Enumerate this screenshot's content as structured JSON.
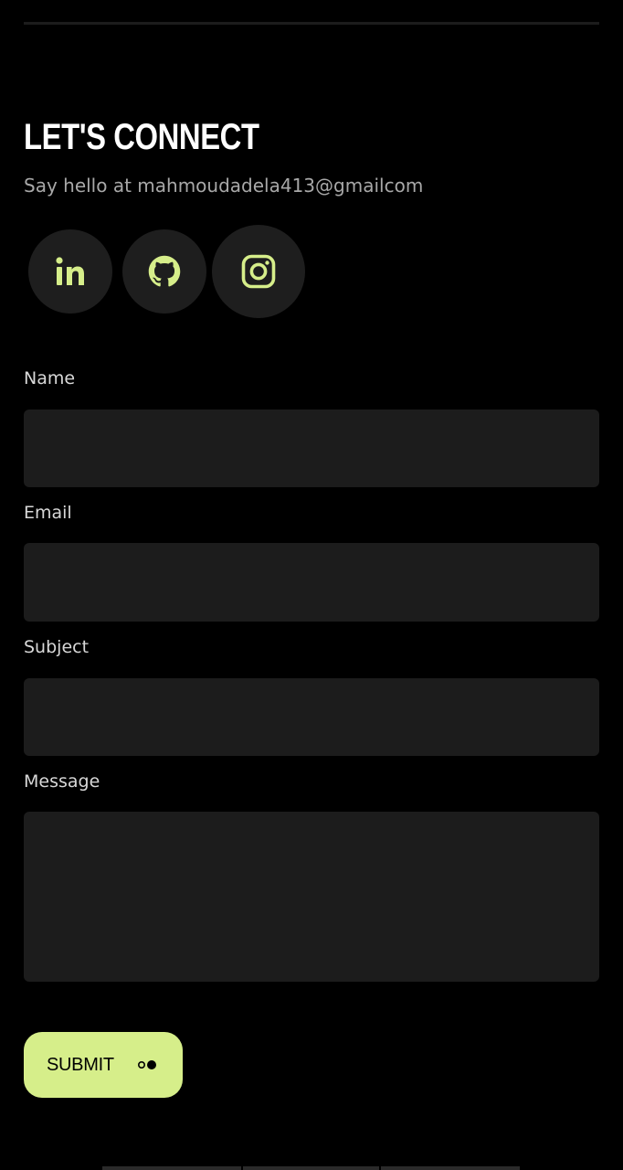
{
  "contact": {
    "heading": "LET'S CONNECT",
    "subtitle": "Say hello at mahmoudadela413@gmailcom"
  },
  "social": [
    {
      "name": "LinkedIn",
      "icon": "linkedin-icon"
    },
    {
      "name": "GitHub",
      "icon": "github-icon"
    },
    {
      "name": "Instagram",
      "icon": "instagram-icon"
    }
  ],
  "form": {
    "name_label": "Name",
    "email_label": "Email",
    "subject_label": "Subject",
    "message_label": "Message",
    "name_value": "",
    "email_value": "",
    "subject_value": "",
    "message_value": "",
    "submit_label": "SUBMIT",
    "submit_icon": "toggle-dots-icon"
  },
  "colors": {
    "background": "#000000",
    "accent": "#d6ee8a",
    "field_background": "#1c1c1c",
    "icon_circle": "#1e1e1e",
    "text": "#ffffff",
    "muted_text": "#a8a8a8"
  }
}
